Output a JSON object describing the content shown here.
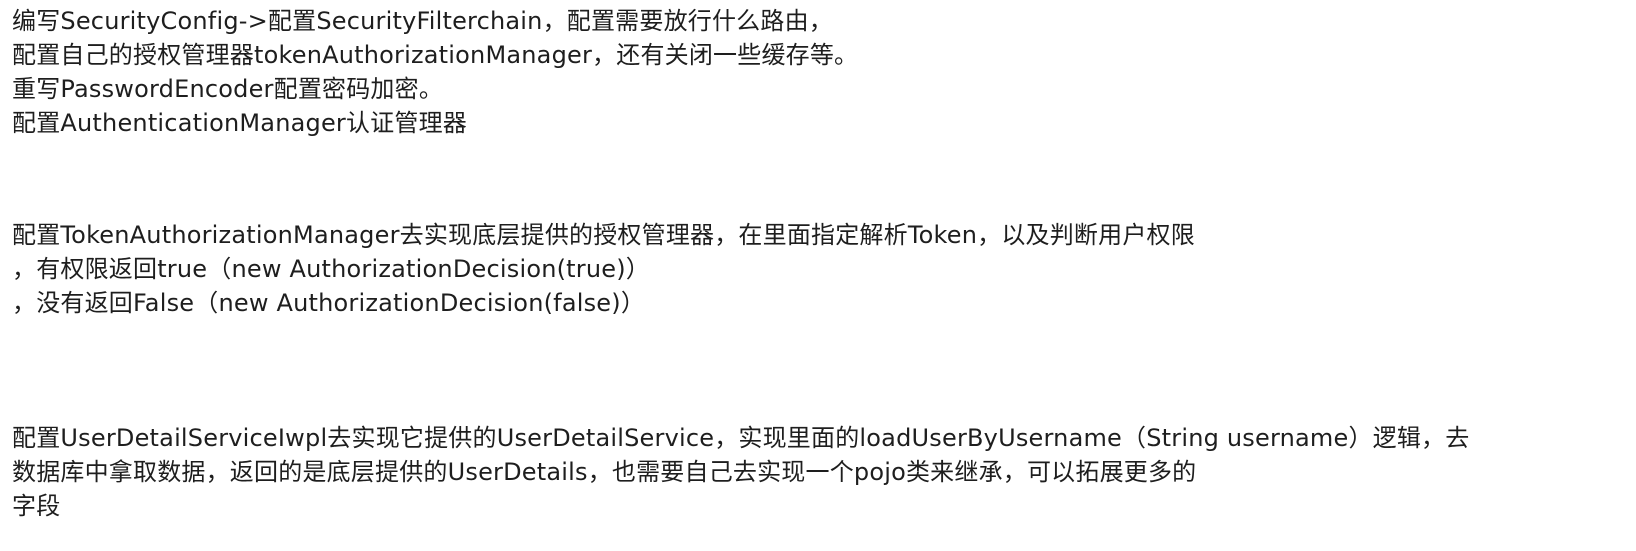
{
  "blocks": [
    {
      "lines": [
        "编写SecurityConfig->配置SecurityFilterchain，配置需要放行什么路由，",
        "配置自己的授权管理器tokenAuthorizationManager，还有关闭一些缓存等。",
        "重写PasswordEncoder配置密码加密。",
        "配置AuthenticationManager认证管理器"
      ]
    },
    {
      "lines": [
        "配置TokenAuthorizationManager去实现底层提供的授权管理器，在里面指定解析Token，以及判断用户权限",
        "，有权限返回true（new AuthorizationDecision(true)）",
        "，没有返回False（new AuthorizationDecision(false)）"
      ]
    },
    {
      "lines": [
        "配置UserDetailServiceIwpl去实现它提供的UserDetailService，实现里面的loadUserByUsername（String username）逻辑，去",
        "数据库中拿取数据，返回的是底层提供的UserDetails，也需要自己去实现一个pojo类来继承，可以拓展更多的",
        "字段"
      ]
    }
  ]
}
